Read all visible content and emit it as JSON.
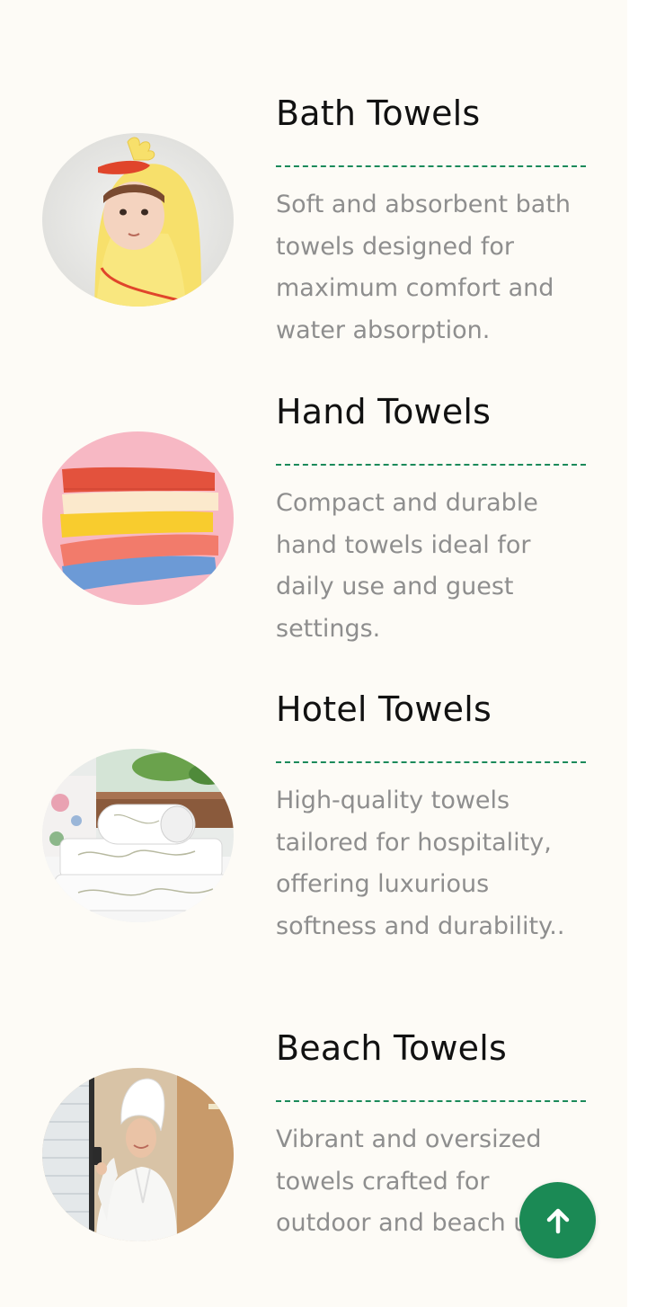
{
  "products": [
    {
      "title": "Bath Towels",
      "description": "Soft and absorbent bath towels designed for maximum comfort and water absorption.",
      "image": "baby-in-hooded-duck-towel"
    },
    {
      "title": "Hand Towels",
      "description": "Compact and durable hand towels ideal for daily use and guest settings.",
      "image": "stack-of-colorful-hand-towels"
    },
    {
      "title": "Hotel Towels",
      "description": "High-quality towels tailored for hospitality, offering luxurious softness and durability..",
      "image": "rolled-white-hotel-towels-on-bed"
    },
    {
      "title": "Beach Towels",
      "description": "Vibrant and oversized towels crafted for outdoor and beach use..",
      "image": "woman-in-bathrobe-with-phone"
    }
  ],
  "scroll_top": {
    "icon": "arrow-up-icon",
    "color": "#1b8a55"
  },
  "colors": {
    "background": "#fdfbf6",
    "title": "#111111",
    "description": "#8e8e8e",
    "divider": "#1b8a5a"
  }
}
